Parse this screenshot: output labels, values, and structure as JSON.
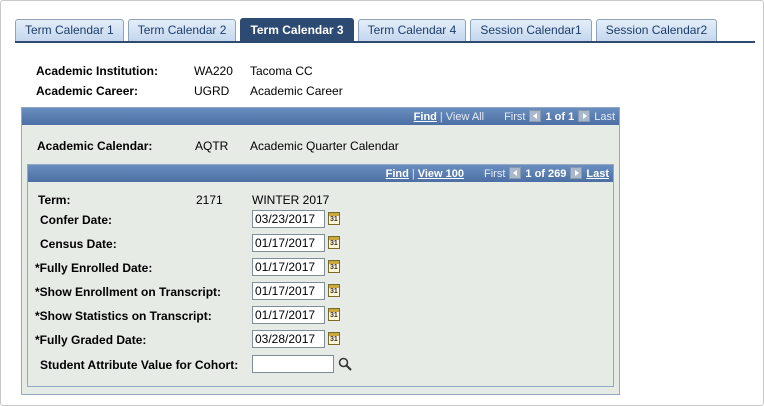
{
  "tabs": [
    {
      "label": "Term Calendar 1",
      "active": false
    },
    {
      "label": "Term Calendar 2",
      "active": false
    },
    {
      "label": "Term Calendar 3",
      "active": true
    },
    {
      "label": "Term Calendar 4",
      "active": false
    },
    {
      "label": "Session Calendar1",
      "active": false
    },
    {
      "label": "Session Calendar2",
      "active": false
    }
  ],
  "header": {
    "institution_label": "Academic Institution:",
    "institution_code": "WA220",
    "institution_name": "Tacoma CC",
    "career_label": "Academic Career:",
    "career_code": "UGRD",
    "career_name": "Academic Career"
  },
  "outer_nav": {
    "find": "Find",
    "sep": "|",
    "view": "View All",
    "first": "First",
    "count": "1 of 1",
    "last": "Last"
  },
  "calendar": {
    "label": "Academic Calendar:",
    "code": "AQTR",
    "name": "Academic Quarter Calendar"
  },
  "inner_nav": {
    "find": "Find",
    "sep": "|",
    "view": "View 100",
    "first": "First",
    "count": "1 of 269",
    "last": "Last"
  },
  "term": {
    "label": "Term:",
    "code": "2171",
    "name": "WINTER 2017"
  },
  "fields": {
    "confer": {
      "label": "Confer Date:",
      "value": "03/23/2017"
    },
    "census": {
      "label": "Census Date:",
      "value": "01/17/2017"
    },
    "fully_enrolled": {
      "label": "*Fully Enrolled Date:",
      "value": "01/17/2017"
    },
    "show_enrollment": {
      "label": "*Show Enrollment on Transcript:",
      "value": "01/17/2017"
    },
    "show_statistics": {
      "label": "*Show Statistics on Transcript:",
      "value": "01/17/2017"
    },
    "fully_graded": {
      "label": "*Fully Graded Date:",
      "value": "03/28/2017"
    },
    "cohort": {
      "label": "Student Attribute Value for Cohort:",
      "value": ""
    }
  },
  "calendar_icon_text": "31",
  "icons": {
    "calendar": "calendar-icon",
    "lookup": "magnifier-icon",
    "prev": "arrow-left-icon",
    "next": "arrow-right-icon"
  },
  "colors": {
    "tab_active": "#2d4a72",
    "nav_bar": "#5a7db3",
    "panel_bg": "#e6ebe6"
  }
}
